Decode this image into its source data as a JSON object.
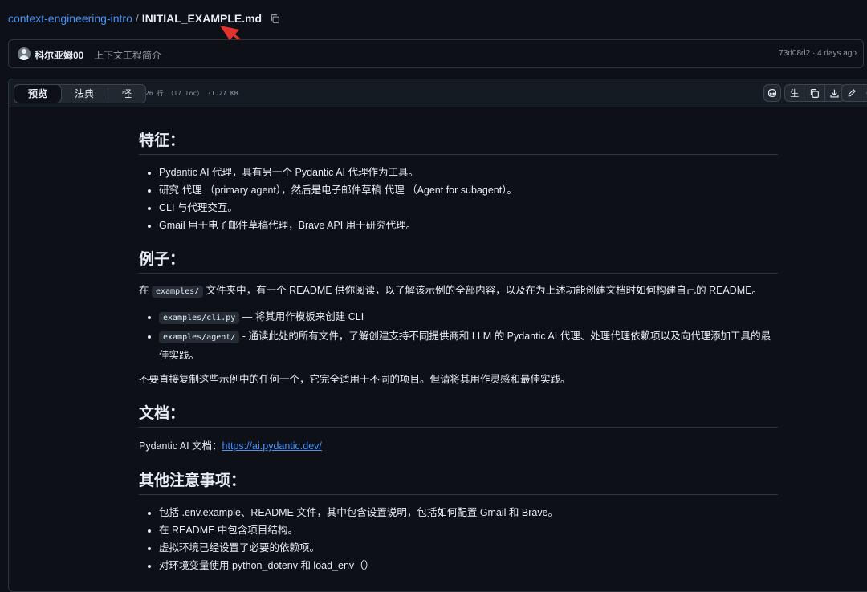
{
  "breadcrumb": {
    "repo": "context-engineering-intro",
    "separator": "/",
    "file": "INITIAL_EXAMPLE.md"
  },
  "commit": {
    "author": "科尔亚姆00",
    "message": "上下文工程简介",
    "sha": "73d08d2",
    "dot": "·",
    "age": "4 days ago"
  },
  "file_header": {
    "tabs": [
      "预览",
      "法典",
      "怪"
    ],
    "info": "26 行 （17 loc） ·1.27 KB",
    "raw_label": "生"
  },
  "icons": [
    "copy-icon",
    "arrow-annotation-icon",
    "copilot-icon",
    "download-icon",
    "edit-icon",
    "chevron-down-icon",
    "avatar"
  ],
  "colors": {
    "bg": "#0d1117",
    "link": "#4493f8",
    "arrow": "#e5322d"
  },
  "doc": {
    "features": {
      "heading": "特征：",
      "items": [
        "Pydantic AI 代理，具有另一个 Pydantic AI 代理作为工具。",
        "研究 代理 （primary agent），然后是电子邮件草稿 代理 （Agent for subagent）。",
        "CLI 与代理交互。",
        "Gmail 用于电子邮件草稿代理，Brave API 用于研究代理。"
      ]
    },
    "examples": {
      "heading": "例子：",
      "intro_prefix": "在",
      "intro_code": "examples/",
      "intro_suffix": "文件夹中，有一个 README 供你阅读，以了解该示例的全部内容，以及在为上述功能创建文档时如何构建自己的 README。",
      "items": [
        {
          "code": "examples/cli.py",
          "text": "— 将其用作模板来创建 CLI"
        },
        {
          "code": "examples/agent/",
          "text": "- 通读此处的所有文件，了解创建支持不同提供商和 LLM 的 Pydantic AI 代理、处理代理依赖项以及向代理添加工具的最佳实践。"
        }
      ],
      "note": "不要直接复制这些示例中的任何一个，它完全适用于不同的项目。但请将其用作灵感和最佳实践。"
    },
    "docs": {
      "heading": "文档：",
      "label": "Pydantic AI 文档：",
      "url": "https://ai.pydantic.dev/"
    },
    "other": {
      "heading": "其他注意事项：",
      "items": [
        "包括 .env.example、README 文件，其中包含设置说明，包括如何配置 Gmail 和 Brave。",
        "在 README 中包含项目结构。",
        "虚拟环境已经设置了必要的依赖项。",
        "对环境变量使用 python_dotenv 和 load_env（）"
      ]
    }
  }
}
